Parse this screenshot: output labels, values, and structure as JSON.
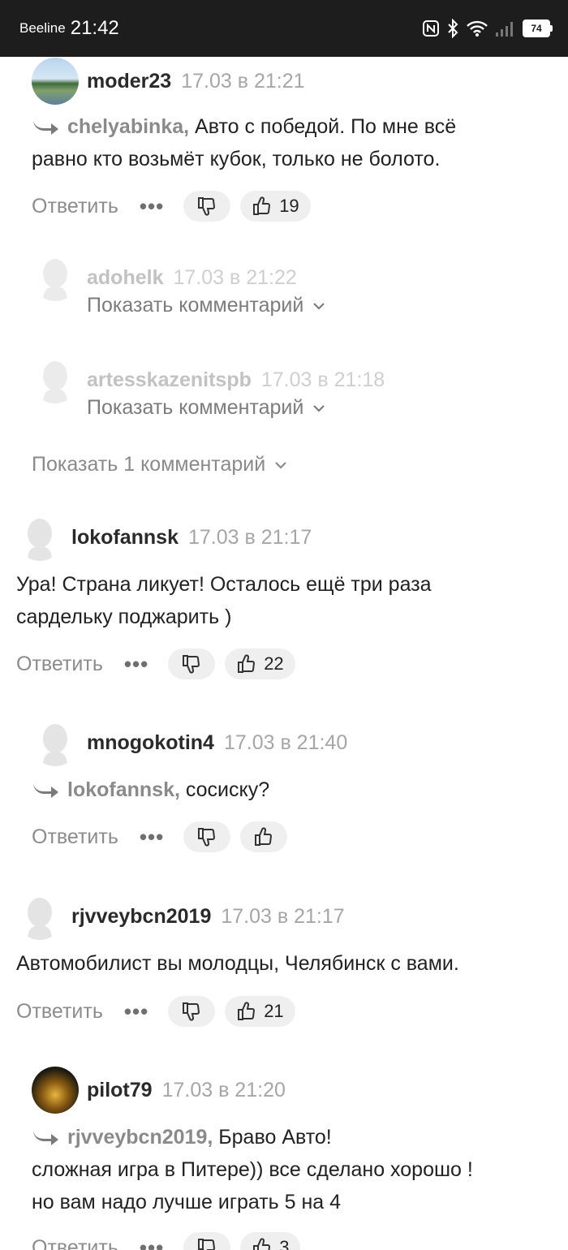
{
  "status_bar": {
    "carrier": "Beeline",
    "time": "21:42",
    "battery": "74"
  },
  "labels": {
    "reply": "Ответить",
    "show_comment": "Показать комментарий",
    "show_more": "Показать 1 комментарий"
  },
  "comments": [
    {
      "user": "moder23",
      "date": "17.03 в 21:21",
      "reply_to": "chelyabinka,",
      "text": "Авто с победой. По мне всё\nравно кто возьмёт кубок, только не болото.",
      "likes": "19"
    },
    {
      "user": "adohelk",
      "date": "17.03 в 21:22"
    },
    {
      "user": "artesskazenitspb",
      "date": "17.03 в 21:18"
    },
    {
      "user": "lokofannsk",
      "date": "17.03 в 21:17",
      "text": "Ура! Страна ликует! Осталось ещё три раза\nсардельку поджарить )",
      "likes": "22"
    },
    {
      "user": "mnogokotin4",
      "date": "17.03 в 21:40",
      "reply_to": "lokofannsk,",
      "text": "сосиску?",
      "likes": ""
    },
    {
      "user": "rjvveybcn2019",
      "date": "17.03 в 21:17",
      "text": "Автомобилист вы молодцы, Челябинск с вами.",
      "likes": "21"
    },
    {
      "user": "pilot79",
      "date": "17.03 в 21:20",
      "reply_to": "rjvveybcn2019,",
      "text": "Браво Авто!\nсложная игра в Питере)) все сделано хорошо !\nно вам надо лучше играть 5 на 4",
      "likes": "3"
    }
  ]
}
